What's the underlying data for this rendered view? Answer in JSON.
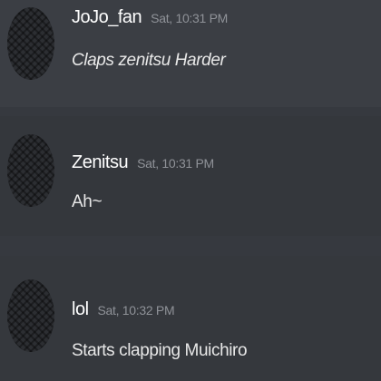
{
  "messages": [
    {
      "username": "JoJo_fan",
      "timestamp": "Sat, 10:31 PM",
      "content": "Claps zenitsu Harder",
      "content_style": "italic"
    },
    {
      "username": "Zenitsu",
      "timestamp": "Sat, 10:31 PM",
      "content": "Ah~",
      "content_style": "normal"
    },
    {
      "username": "lol",
      "timestamp": "Sat, 10:32 PM",
      "content": "Starts clapping Muichiro",
      "content_style": "normal"
    }
  ],
  "colors": {
    "background": "#36393f",
    "username": "#ffffff",
    "timestamp": "#8f9298",
    "message_text": "#e8e8e8"
  },
  "icons": {
    "avatar": "avatar-image"
  }
}
